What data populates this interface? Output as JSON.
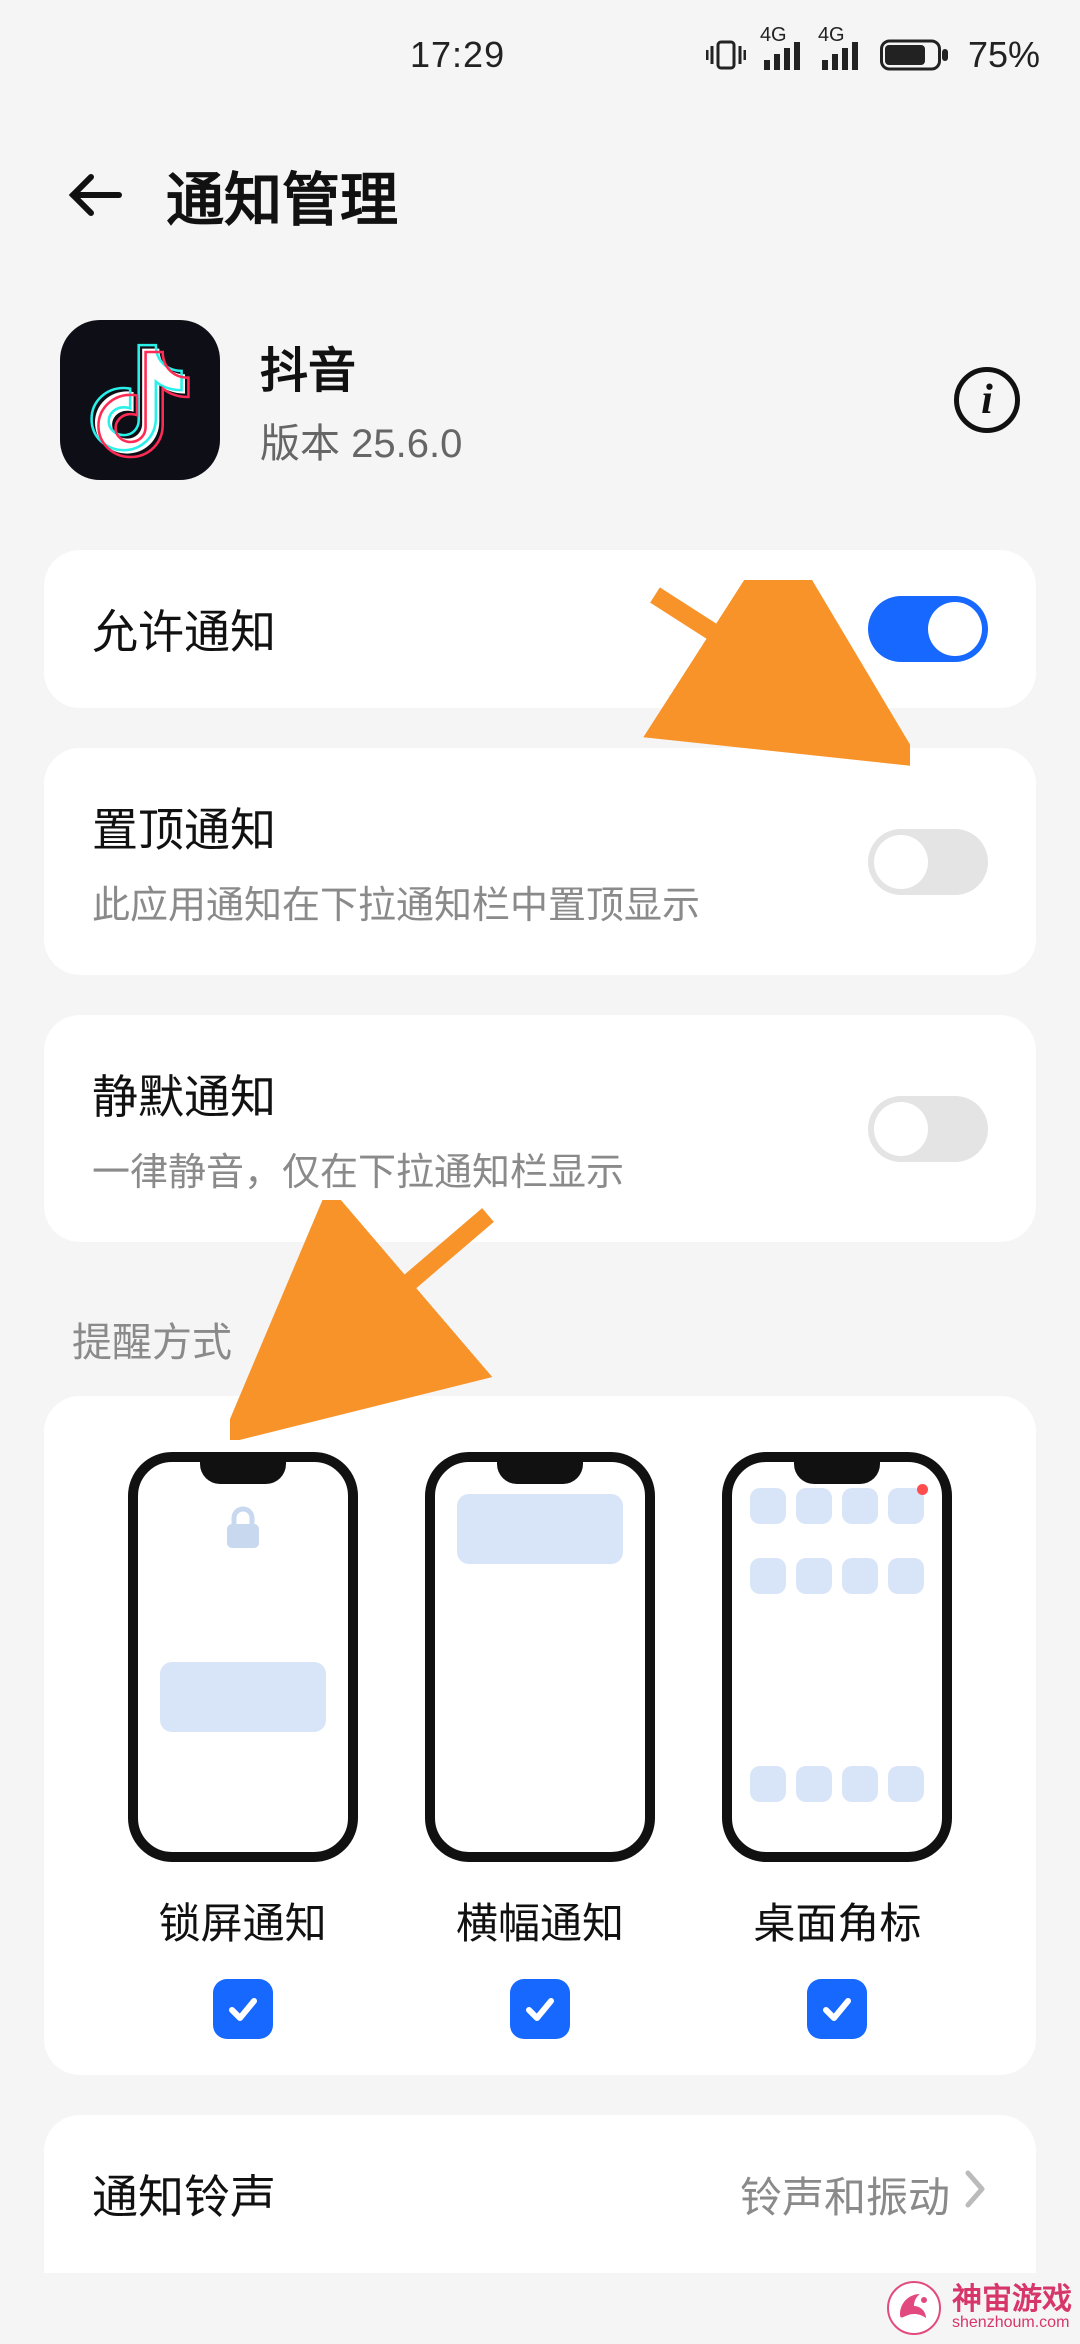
{
  "status": {
    "time": "17:29",
    "signal1": "4G",
    "signal2": "4G",
    "battery_pct": "75%"
  },
  "header": {
    "title": "通知管理"
  },
  "app": {
    "name": "抖音",
    "version_label": "版本 25.6.0"
  },
  "rows": {
    "allow": {
      "title": "允许通知",
      "on": true
    },
    "pin": {
      "title": "置顶通知",
      "sub": "此应用通知在下拉通知栏中置顶显示",
      "on": false
    },
    "silent": {
      "title": "静默通知",
      "sub": "一律静音，仅在下拉通知栏显示",
      "on": false
    }
  },
  "section": {
    "alert_style": "提醒方式"
  },
  "alerts": {
    "lock": {
      "label": "锁屏通知",
      "checked": true
    },
    "banner": {
      "label": "横幅通知",
      "checked": true
    },
    "badge": {
      "label": "桌面角标",
      "checked": true
    }
  },
  "ringtone": {
    "title": "通知铃声",
    "value": "铃声和振动"
  },
  "watermark": {
    "text": "神宙游戏",
    "sub": "shenzhoum.com"
  }
}
